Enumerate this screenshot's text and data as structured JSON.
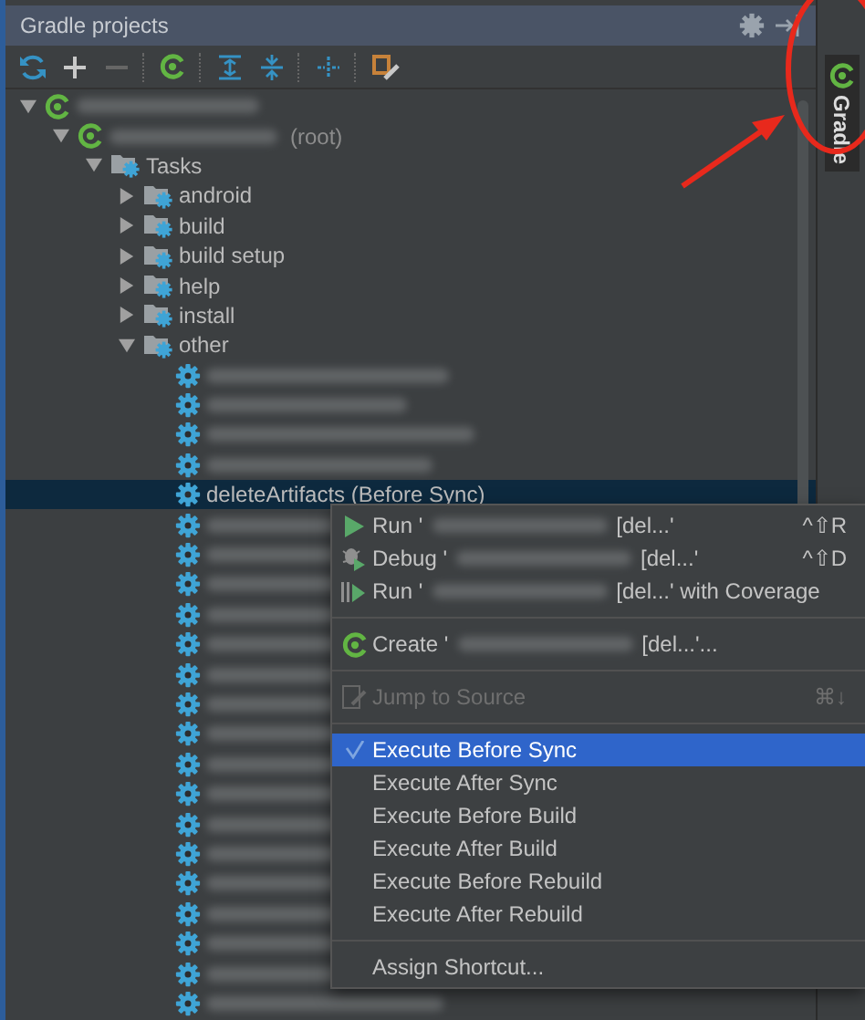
{
  "panel": {
    "title": "Gradle projects"
  },
  "side_tab": {
    "label": "Gradle",
    "selected": true
  },
  "tree": [
    {
      "kind": "project",
      "expanded": true,
      "selected": false,
      "children": [
        {
          "kind": "module",
          "suffix": "(root)",
          "expanded": true,
          "selected": false,
          "children": [
            {
              "kind": "folder",
              "label": "Tasks",
              "expanded": true,
              "selected": false,
              "children": [
                {
                  "kind": "folder",
                  "label": "android",
                  "expanded": false,
                  "selected": false
                },
                {
                  "kind": "folder",
                  "label": "build",
                  "expanded": false,
                  "selected": false
                },
                {
                  "kind": "folder",
                  "label": "build setup",
                  "expanded": false,
                  "selected": false
                },
                {
                  "kind": "folder",
                  "label": "help",
                  "expanded": false,
                  "selected": false
                },
                {
                  "kind": "folder",
                  "label": "install",
                  "expanded": false,
                  "selected": false
                },
                {
                  "kind": "folder",
                  "label": "other",
                  "expanded": true,
                  "selected": false,
                  "children": [
                    {
                      "kind": "task_blurred",
                      "selected": false
                    },
                    {
                      "kind": "task_blurred",
                      "selected": false
                    },
                    {
                      "kind": "task_blurred",
                      "selected": false
                    },
                    {
                      "kind": "task_blurred",
                      "selected": false
                    },
                    {
                      "kind": "task",
                      "label": "deleteArtifacts (Before Sync)",
                      "selected": true
                    },
                    {
                      "kind": "task_blurred",
                      "selected": false
                    },
                    {
                      "kind": "task_blurred",
                      "selected": false
                    },
                    {
                      "kind": "task_blurred",
                      "selected": false
                    },
                    {
                      "kind": "task_blurred",
                      "selected": false
                    },
                    {
                      "kind": "task_blurred",
                      "selected": false
                    },
                    {
                      "kind": "task_blurred",
                      "selected": false
                    },
                    {
                      "kind": "task_blurred",
                      "selected": false
                    },
                    {
                      "kind": "task_blurred",
                      "selected": false
                    },
                    {
                      "kind": "task_blurred",
                      "selected": false
                    },
                    {
                      "kind": "task_blurred",
                      "selected": false
                    },
                    {
                      "kind": "task_blurred",
                      "selected": false
                    },
                    {
                      "kind": "task_blurred",
                      "selected": false
                    },
                    {
                      "kind": "task_blurred",
                      "selected": false
                    },
                    {
                      "kind": "task_blurred",
                      "selected": false
                    },
                    {
                      "kind": "task_blurred",
                      "selected": false
                    },
                    {
                      "kind": "task_blurred",
                      "selected": false
                    },
                    {
                      "kind": "task_blurred",
                      "selected": false
                    }
                  ]
                }
              ]
            }
          ]
        }
      ]
    }
  ],
  "context_menu": [
    {
      "kind": "run",
      "prefix": "Run '",
      "suffix": "[del...'",
      "shortcut": "^⇧R",
      "disabled": false
    },
    {
      "kind": "debug",
      "prefix": "Debug '",
      "suffix": "[del...'",
      "shortcut": "^⇧D",
      "disabled": false
    },
    {
      "kind": "coverage",
      "prefix": "Run '",
      "suffix": "[del...' with Coverage",
      "disabled": false
    },
    {
      "kind": "separator"
    },
    {
      "kind": "create",
      "prefix": "Create '",
      "suffix": "[del...'...",
      "disabled": false
    },
    {
      "kind": "separator"
    },
    {
      "kind": "jump",
      "prefix": "Jump to Source",
      "shortcut": "⌘↓",
      "disabled": true
    },
    {
      "kind": "separator"
    },
    {
      "kind": "check",
      "label": "Execute Before Sync",
      "checked": true,
      "selected": true
    },
    {
      "kind": "check",
      "label": "Execute After Sync",
      "checked": false,
      "selected": false
    },
    {
      "kind": "check",
      "label": "Execute Before Build",
      "checked": false,
      "selected": false
    },
    {
      "kind": "check",
      "label": "Execute After Build",
      "checked": false,
      "selected": false
    },
    {
      "kind": "check",
      "label": "Execute Before Rebuild",
      "checked": false,
      "selected": false
    },
    {
      "kind": "check",
      "label": "Execute After Rebuild",
      "checked": false,
      "selected": false
    },
    {
      "kind": "separator"
    },
    {
      "kind": "plain",
      "prefix": "Assign Shortcut...",
      "disabled": false
    }
  ]
}
